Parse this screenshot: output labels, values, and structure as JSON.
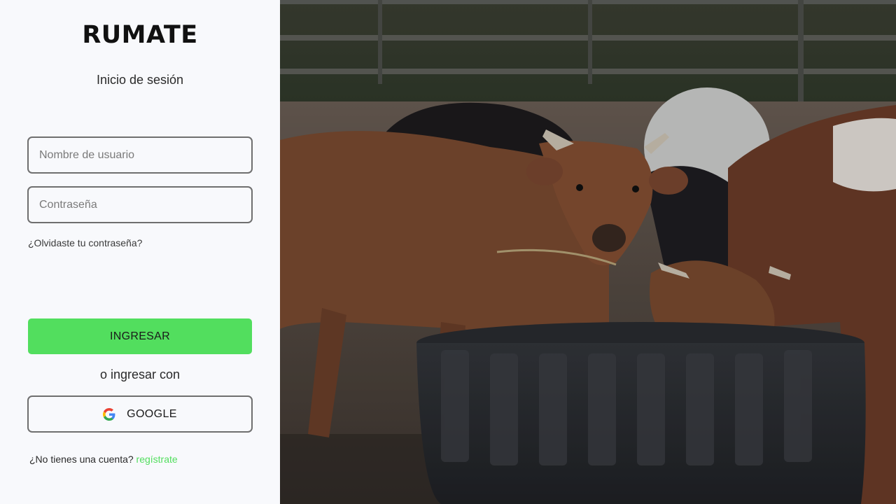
{
  "brand": {
    "name": "RUMATE"
  },
  "login": {
    "title": "Inicio de sesión",
    "username_placeholder": "Nombre de usuario",
    "password_placeholder": "Contraseña",
    "forgot_password": "¿Olvidaste tu contraseña?",
    "submit_label": "INGRESAR",
    "alt_login_text": "o ingresar con",
    "google_label": "GOOGLE",
    "signup_prompt": "¿No tienes una cuenta?",
    "signup_link": "regístrate"
  },
  "colors": {
    "accent": "#52de5e",
    "panel_bg": "#f8f9fc",
    "border": "#6f6f6f"
  },
  "icons": {
    "google": "google-icon"
  }
}
